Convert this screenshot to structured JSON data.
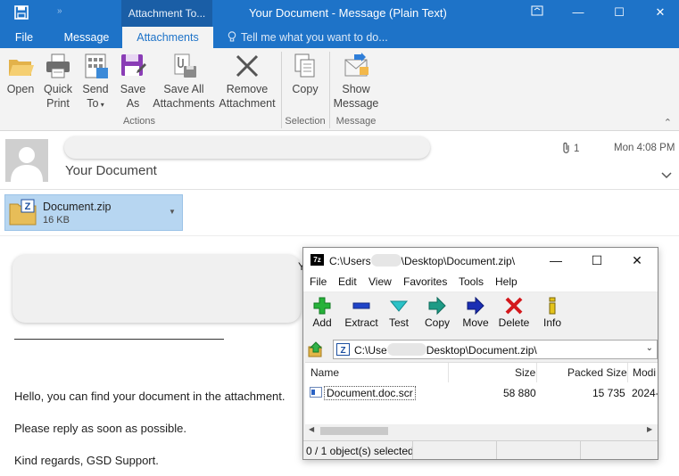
{
  "outlook": {
    "context_tab": "Attachment To...",
    "window_title": "Your Document  -  Message (Plain Text)",
    "tabs": {
      "file": "File",
      "message": "Message",
      "attachments": "Attachments"
    },
    "tell_me": "Tell me what you want to do...",
    "ribbon": {
      "open": "Open",
      "quick_print_1": "Quick",
      "quick_print_2": "Print",
      "send_to_1": "Send",
      "send_to_2": "To",
      "save_as_1": "Save",
      "save_as_2": "As",
      "save_all_1": "Save All",
      "save_all_2": "Attachments",
      "remove_1": "Remove",
      "remove_2": "Attachment",
      "copy": "Copy",
      "show_msg_1": "Show",
      "show_msg_2": "Message",
      "groups": {
        "actions": "Actions",
        "selection": "Selection",
        "message": "Message"
      }
    },
    "header": {
      "subject": "Your Document",
      "attachment_count": "1",
      "time": "Mon 4:08 PM"
    },
    "attachment": {
      "name": "Document.zip",
      "size": "16 KB"
    },
    "body": {
      "line1": "Hello, you can find your document in the attachment.",
      "line2": "Please reply as soon as possible.",
      "line3": "Kind regards, GSD Support."
    }
  },
  "sevenzip": {
    "title_prefix": "C:\\Users",
    "title_suffix": "\\Desktop\\Document.zip\\",
    "menu": [
      "File",
      "Edit",
      "View",
      "Favorites",
      "Tools",
      "Help"
    ],
    "toolbar": {
      "add": "Add",
      "extract": "Extract",
      "test": "Test",
      "copy": "Copy",
      "move": "Move",
      "delete": "Delete",
      "info": "Info"
    },
    "address_prefix": "C:\\Use",
    "address_suffix": "Desktop\\Document.zip\\",
    "columns": {
      "name": "Name",
      "size": "Size",
      "packed": "Packed Size",
      "modified": "Modi"
    },
    "row": {
      "name": "Document.doc.scr",
      "size": "58 880",
      "packed": "15 735",
      "modified": "2024-"
    },
    "status": "0 / 1 object(s) selected"
  },
  "colors": {
    "outlook_blue": "#1e73c8",
    "selection_blue": "#b7d6f1"
  }
}
